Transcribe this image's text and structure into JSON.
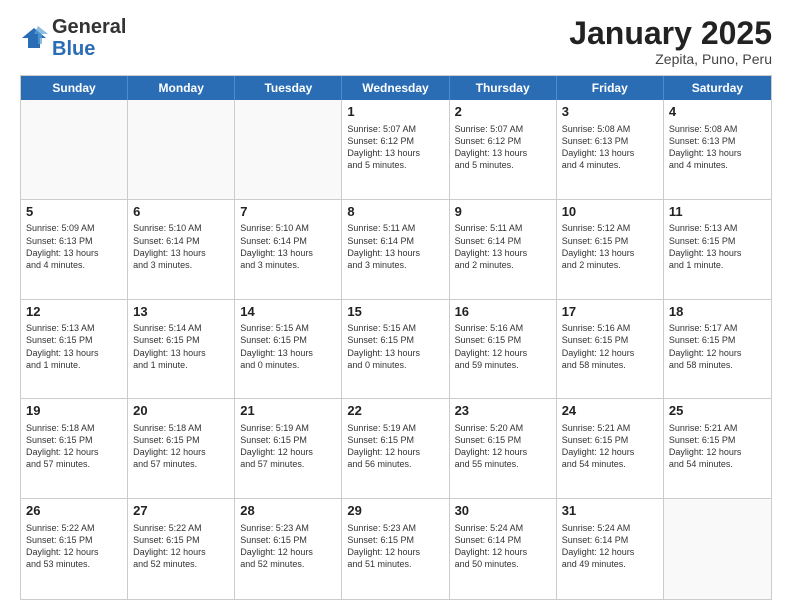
{
  "header": {
    "logo_general": "General",
    "logo_blue": "Blue",
    "month_title": "January 2025",
    "subtitle": "Zepita, Puno, Peru"
  },
  "weekdays": [
    "Sunday",
    "Monday",
    "Tuesday",
    "Wednesday",
    "Thursday",
    "Friday",
    "Saturday"
  ],
  "weeks": [
    [
      {
        "day": "",
        "info": ""
      },
      {
        "day": "",
        "info": ""
      },
      {
        "day": "",
        "info": ""
      },
      {
        "day": "1",
        "info": "Sunrise: 5:07 AM\nSunset: 6:12 PM\nDaylight: 13 hours\nand 5 minutes."
      },
      {
        "day": "2",
        "info": "Sunrise: 5:07 AM\nSunset: 6:12 PM\nDaylight: 13 hours\nand 5 minutes."
      },
      {
        "day": "3",
        "info": "Sunrise: 5:08 AM\nSunset: 6:13 PM\nDaylight: 13 hours\nand 4 minutes."
      },
      {
        "day": "4",
        "info": "Sunrise: 5:08 AM\nSunset: 6:13 PM\nDaylight: 13 hours\nand 4 minutes."
      }
    ],
    [
      {
        "day": "5",
        "info": "Sunrise: 5:09 AM\nSunset: 6:13 PM\nDaylight: 13 hours\nand 4 minutes."
      },
      {
        "day": "6",
        "info": "Sunrise: 5:10 AM\nSunset: 6:14 PM\nDaylight: 13 hours\nand 3 minutes."
      },
      {
        "day": "7",
        "info": "Sunrise: 5:10 AM\nSunset: 6:14 PM\nDaylight: 13 hours\nand 3 minutes."
      },
      {
        "day": "8",
        "info": "Sunrise: 5:11 AM\nSunset: 6:14 PM\nDaylight: 13 hours\nand 3 minutes."
      },
      {
        "day": "9",
        "info": "Sunrise: 5:11 AM\nSunset: 6:14 PM\nDaylight: 13 hours\nand 2 minutes."
      },
      {
        "day": "10",
        "info": "Sunrise: 5:12 AM\nSunset: 6:15 PM\nDaylight: 13 hours\nand 2 minutes."
      },
      {
        "day": "11",
        "info": "Sunrise: 5:13 AM\nSunset: 6:15 PM\nDaylight: 13 hours\nand 1 minute."
      }
    ],
    [
      {
        "day": "12",
        "info": "Sunrise: 5:13 AM\nSunset: 6:15 PM\nDaylight: 13 hours\nand 1 minute."
      },
      {
        "day": "13",
        "info": "Sunrise: 5:14 AM\nSunset: 6:15 PM\nDaylight: 13 hours\nand 1 minute."
      },
      {
        "day": "14",
        "info": "Sunrise: 5:15 AM\nSunset: 6:15 PM\nDaylight: 13 hours\nand 0 minutes."
      },
      {
        "day": "15",
        "info": "Sunrise: 5:15 AM\nSunset: 6:15 PM\nDaylight: 13 hours\nand 0 minutes."
      },
      {
        "day": "16",
        "info": "Sunrise: 5:16 AM\nSunset: 6:15 PM\nDaylight: 12 hours\nand 59 minutes."
      },
      {
        "day": "17",
        "info": "Sunrise: 5:16 AM\nSunset: 6:15 PM\nDaylight: 12 hours\nand 58 minutes."
      },
      {
        "day": "18",
        "info": "Sunrise: 5:17 AM\nSunset: 6:15 PM\nDaylight: 12 hours\nand 58 minutes."
      }
    ],
    [
      {
        "day": "19",
        "info": "Sunrise: 5:18 AM\nSunset: 6:15 PM\nDaylight: 12 hours\nand 57 minutes."
      },
      {
        "day": "20",
        "info": "Sunrise: 5:18 AM\nSunset: 6:15 PM\nDaylight: 12 hours\nand 57 minutes."
      },
      {
        "day": "21",
        "info": "Sunrise: 5:19 AM\nSunset: 6:15 PM\nDaylight: 12 hours\nand 57 minutes."
      },
      {
        "day": "22",
        "info": "Sunrise: 5:19 AM\nSunset: 6:15 PM\nDaylight: 12 hours\nand 56 minutes."
      },
      {
        "day": "23",
        "info": "Sunrise: 5:20 AM\nSunset: 6:15 PM\nDaylight: 12 hours\nand 55 minutes."
      },
      {
        "day": "24",
        "info": "Sunrise: 5:21 AM\nSunset: 6:15 PM\nDaylight: 12 hours\nand 54 minutes."
      },
      {
        "day": "25",
        "info": "Sunrise: 5:21 AM\nSunset: 6:15 PM\nDaylight: 12 hours\nand 54 minutes."
      }
    ],
    [
      {
        "day": "26",
        "info": "Sunrise: 5:22 AM\nSunset: 6:15 PM\nDaylight: 12 hours\nand 53 minutes."
      },
      {
        "day": "27",
        "info": "Sunrise: 5:22 AM\nSunset: 6:15 PM\nDaylight: 12 hours\nand 52 minutes."
      },
      {
        "day": "28",
        "info": "Sunrise: 5:23 AM\nSunset: 6:15 PM\nDaylight: 12 hours\nand 52 minutes."
      },
      {
        "day": "29",
        "info": "Sunrise: 5:23 AM\nSunset: 6:15 PM\nDaylight: 12 hours\nand 51 minutes."
      },
      {
        "day": "30",
        "info": "Sunrise: 5:24 AM\nSunset: 6:14 PM\nDaylight: 12 hours\nand 50 minutes."
      },
      {
        "day": "31",
        "info": "Sunrise: 5:24 AM\nSunset: 6:14 PM\nDaylight: 12 hours\nand 49 minutes."
      },
      {
        "day": "",
        "info": ""
      }
    ]
  ]
}
